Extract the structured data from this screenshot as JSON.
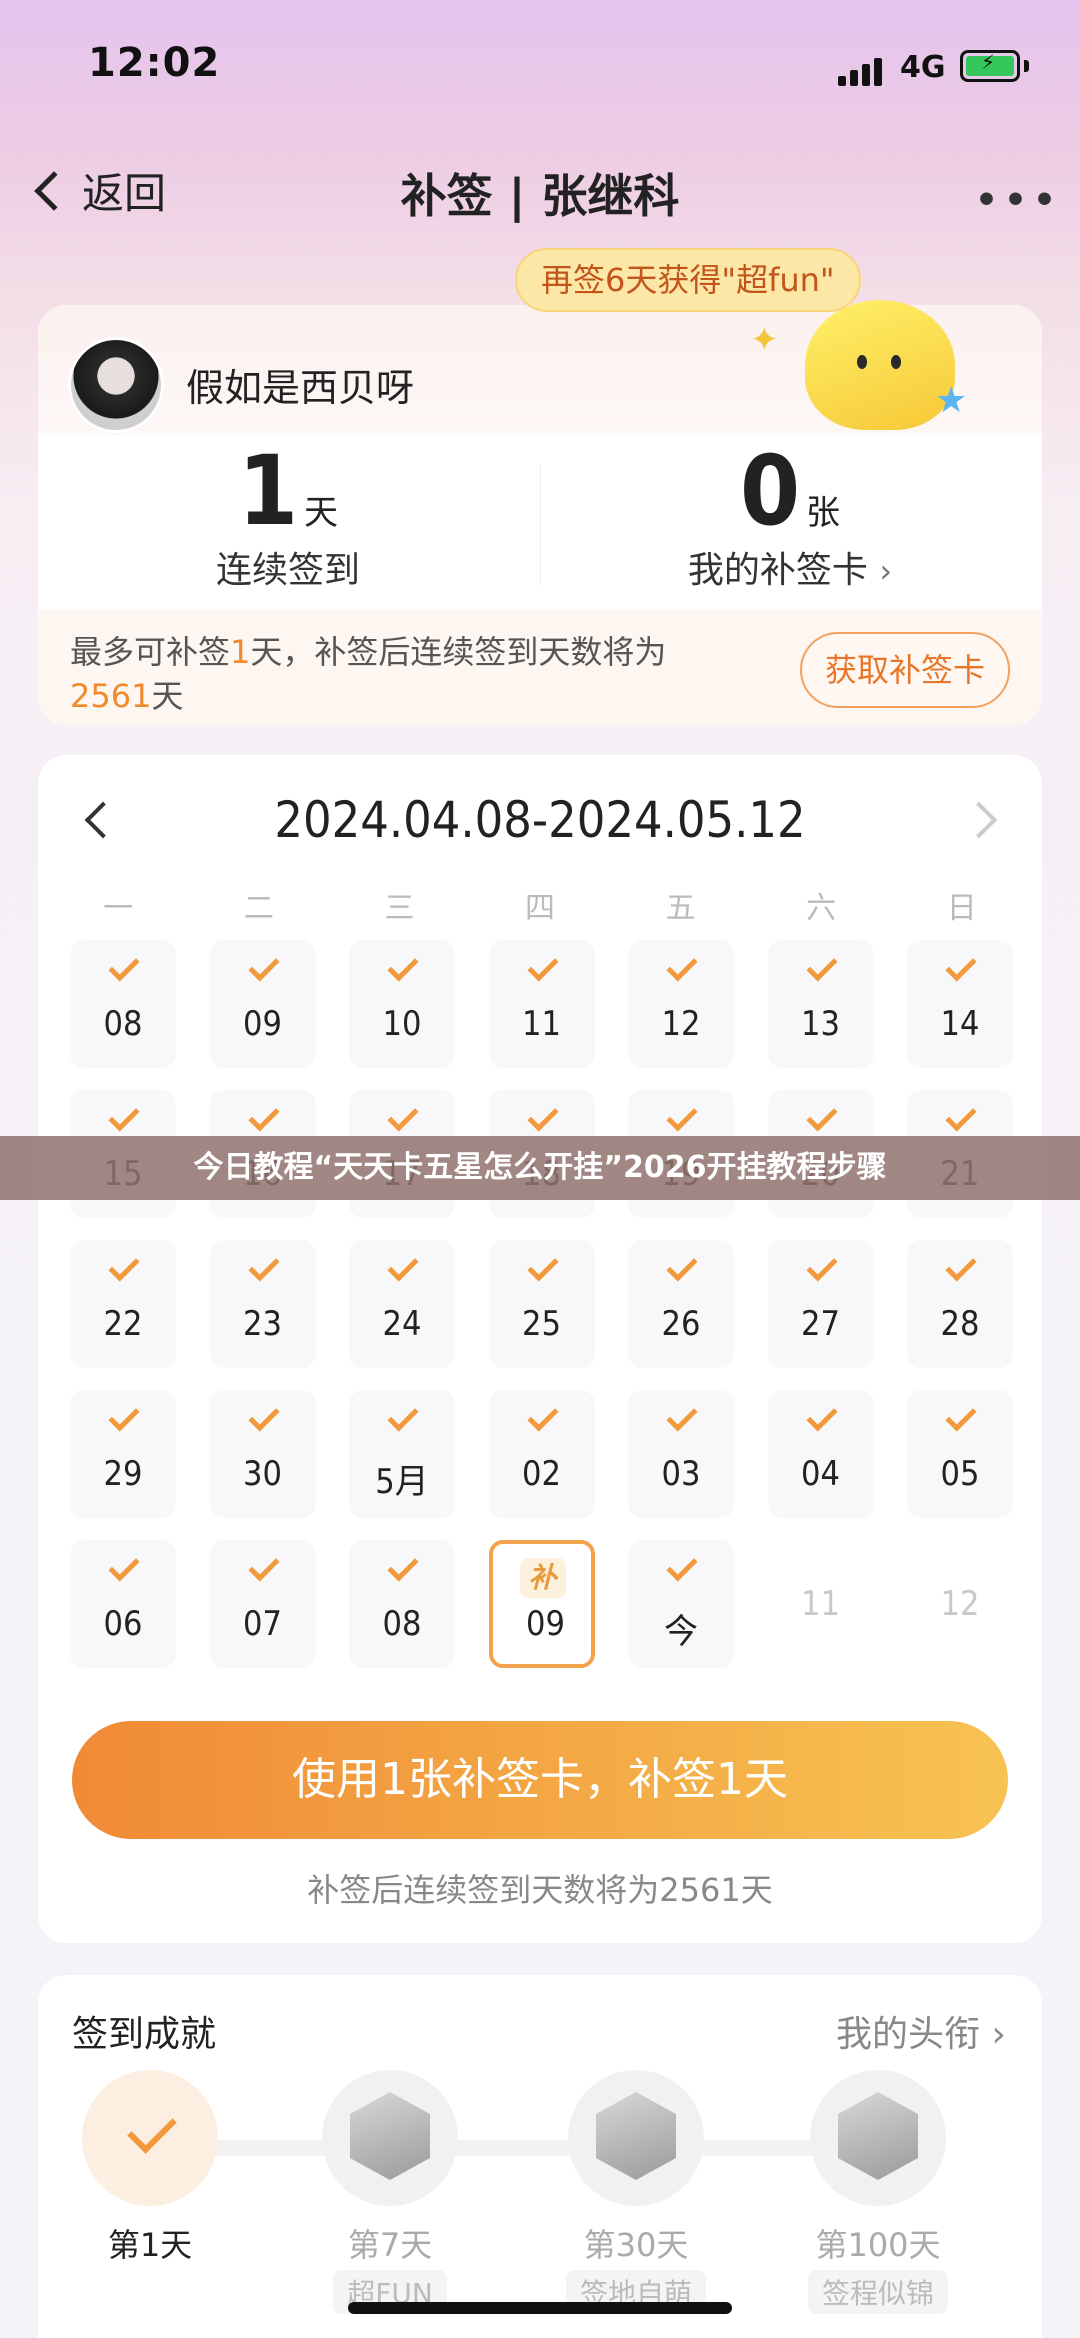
{
  "status": {
    "time": "12:02",
    "network": "4G"
  },
  "nav": {
    "back_label": "返回",
    "title": "补签 | 张继科",
    "more_label": "•••"
  },
  "profile": {
    "name": "假如是西贝呀",
    "promo": "再签6天获得\"超fun\""
  },
  "stats": [
    {
      "num": "1",
      "unit": "天",
      "label": "连续签到",
      "chevron": ""
    },
    {
      "num": "0",
      "unit": "张",
      "label": "我的补签卡",
      "chevron": "›"
    }
  ],
  "info": {
    "text_pre": "最多可补签",
    "text_hl1": "1",
    "text_mid": "天，补签后连续签到天数将为",
    "text_hl2": "2561",
    "text_post": "天",
    "button": "获取补签卡"
  },
  "calendar": {
    "range": "2024.04.08-2024.05.12",
    "weekdays": [
      "一",
      "二",
      "三",
      "四",
      "五",
      "六",
      "日"
    ],
    "days": [
      {
        "label": "08",
        "state": "checked"
      },
      {
        "label": "09",
        "state": "checked"
      },
      {
        "label": "10",
        "state": "checked"
      },
      {
        "label": "11",
        "state": "checked"
      },
      {
        "label": "12",
        "state": "checked"
      },
      {
        "label": "13",
        "state": "checked"
      },
      {
        "label": "14",
        "state": "checked"
      },
      {
        "label": "15",
        "state": "checked"
      },
      {
        "label": "16",
        "state": "checked"
      },
      {
        "label": "17",
        "state": "checked"
      },
      {
        "label": "18",
        "state": "checked"
      },
      {
        "label": "19",
        "state": "checked"
      },
      {
        "label": "20",
        "state": "checked"
      },
      {
        "label": "21",
        "state": "checked"
      },
      {
        "label": "22",
        "state": "checked"
      },
      {
        "label": "23",
        "state": "checked"
      },
      {
        "label": "24",
        "state": "checked"
      },
      {
        "label": "25",
        "state": "checked"
      },
      {
        "label": "26",
        "state": "checked"
      },
      {
        "label": "27",
        "state": "checked"
      },
      {
        "label": "28",
        "state": "checked"
      },
      {
        "label": "29",
        "state": "checked"
      },
      {
        "label": "30",
        "state": "checked"
      },
      {
        "label": "5月",
        "state": "checked"
      },
      {
        "label": "02",
        "state": "checked"
      },
      {
        "label": "03",
        "state": "checked"
      },
      {
        "label": "04",
        "state": "checked"
      },
      {
        "label": "05",
        "state": "checked"
      },
      {
        "label": "06",
        "state": "checked"
      },
      {
        "label": "07",
        "state": "checked"
      },
      {
        "label": "08",
        "state": "checked"
      },
      {
        "label": "09",
        "state": "selected",
        "tag": "补"
      },
      {
        "label": "今",
        "state": "checked"
      },
      {
        "label": "11",
        "state": "future"
      },
      {
        "label": "12",
        "state": "future"
      }
    ]
  },
  "overlay_banner": "今日教程“天天卡五星怎么开挂”2026开挂教程步骤",
  "action": {
    "button": "使用1张补签卡，补签1天",
    "note": "补签后连续签到天数将为2561天"
  },
  "achievements": {
    "title": "签到成就",
    "link": "我的头衔",
    "link_chevron": "›",
    "medals": [
      {
        "label": "第1天",
        "sub": "",
        "done": true,
        "icon": "check-icon"
      },
      {
        "label": "第7天",
        "sub": "超FUN",
        "done": false,
        "icon": "rock-hand-badge-icon"
      },
      {
        "label": "第30天",
        "sub": "签地自萌",
        "done": false,
        "icon": "30-days-badge-icon"
      },
      {
        "label": "第100天",
        "sub": "签程似锦",
        "done": false,
        "icon": "100-days-badge-icon"
      }
    ]
  }
}
